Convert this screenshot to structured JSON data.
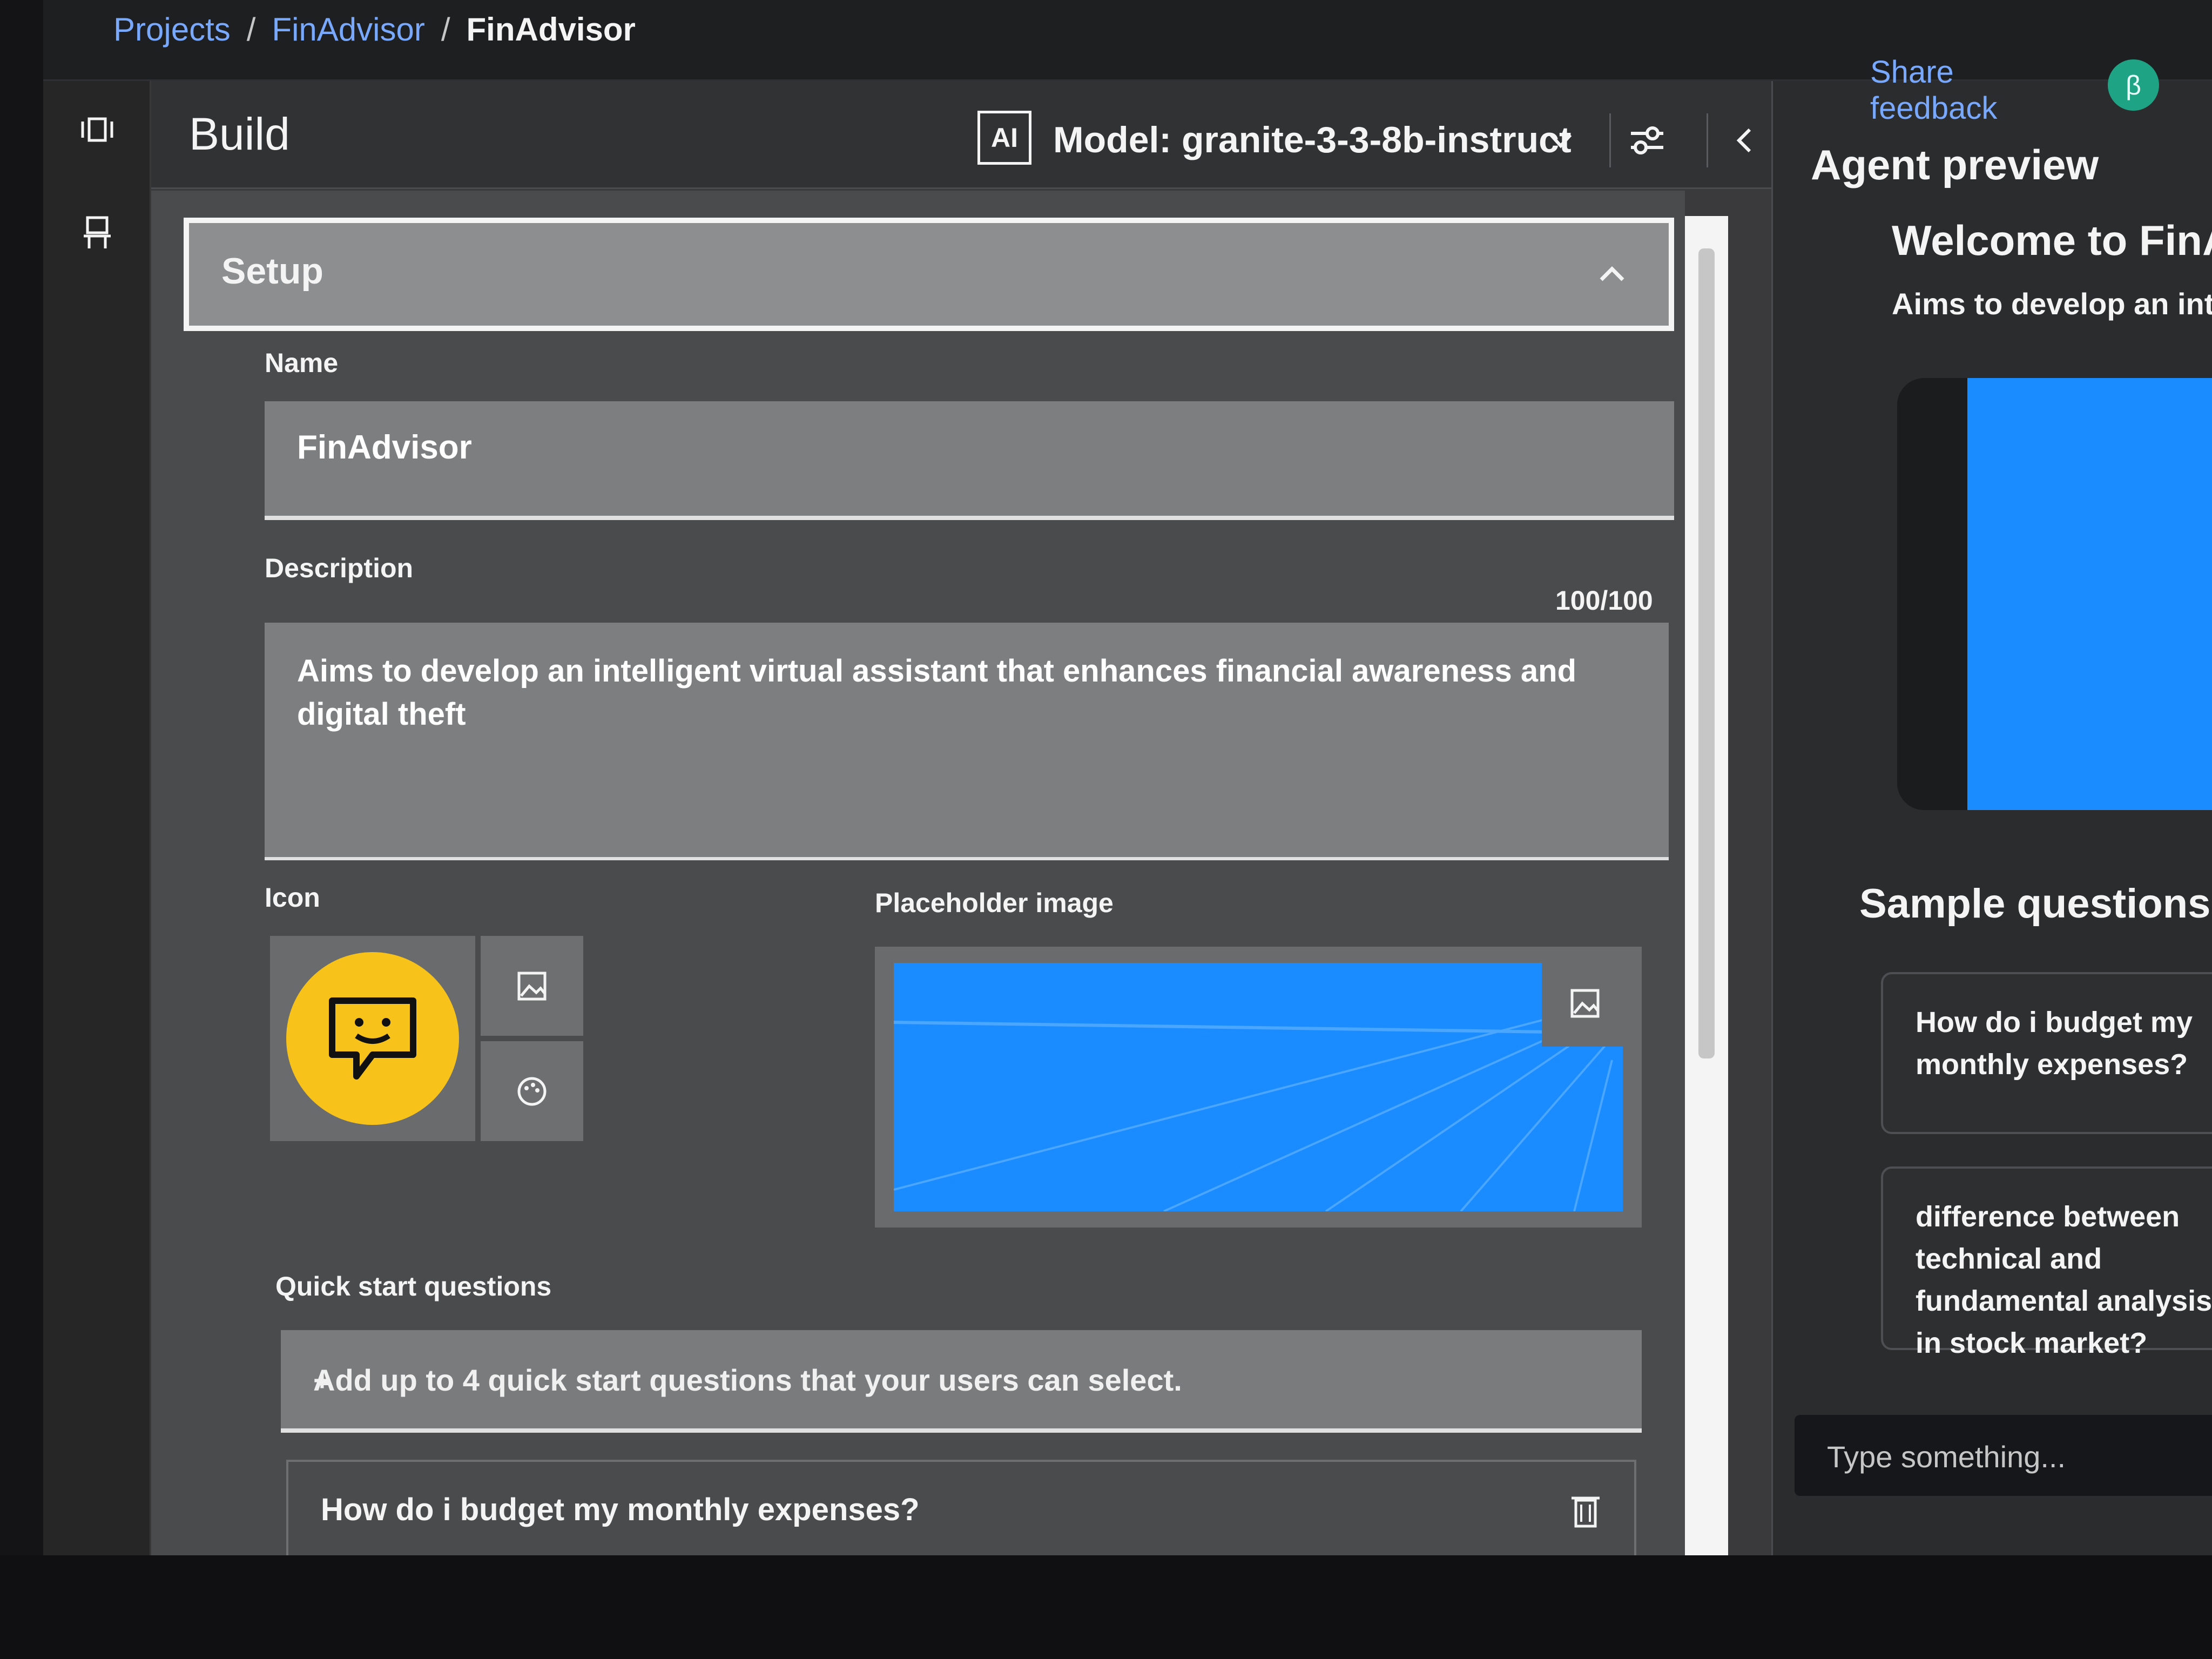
{
  "breadcrumb": {
    "projects": "Projects",
    "sep": "/",
    "project": "FinAdvisor",
    "current": "FinAdvisor"
  },
  "header": {
    "share_feedback": "Share feedback",
    "avatar_initial": "β"
  },
  "build": {
    "title": "Build",
    "ai_badge": "AI",
    "model_label": "Model: granite-3-3-8b-instruct"
  },
  "setup": {
    "title": "Setup",
    "name_label": "Name",
    "name_value": "FinAdvisor",
    "description_label": "Description",
    "description_counter": "100/100",
    "description_value": "Aims to develop an intelligent virtual assistant that enhances financial awareness and digital theft",
    "icon_label": "Icon",
    "placeholder_label": "Placeholder image",
    "quick_label": "Quick start questions",
    "quick_placeholder": "Add up to 4 quick start questions that your users can select.",
    "quick_plus": "+",
    "quick_items": [
      "How do i budget my monthly expenses?"
    ]
  },
  "preview": {
    "title": "Agent preview",
    "welcome": "Welcome to FinAdvisor",
    "welcome_desc": "Aims to develop an intelligent virtual assistant",
    "sample_title": "Sample questions",
    "samples": [
      "How do i budget my monthly expenses?",
      "difference between technical and fundamental analysis in stock market?"
    ],
    "input_placeholder": "Type something..."
  },
  "colors": {
    "accent": "#78a9ff",
    "icon_bg": "#f7c21a",
    "image_blue": "#1a8cff",
    "avatar": "#1fa385"
  }
}
